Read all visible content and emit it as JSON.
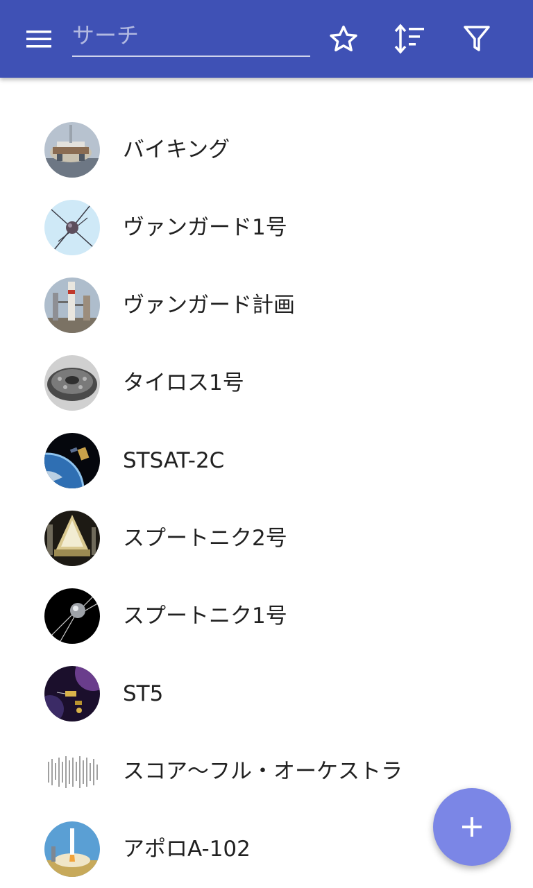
{
  "toolbar": {
    "menu_icon": "menu-icon",
    "search_placeholder": "サーチ",
    "search_value": "",
    "favorite_icon": "star-outline-icon",
    "sort_icon": "sort-icon",
    "filter_icon": "filter-icon",
    "color": "#3f51b5"
  },
  "items": [
    {
      "label": "バイキング"
    },
    {
      "label": "ヴァンガード1号"
    },
    {
      "label": "ヴァンガード計画"
    },
    {
      "label": "タイロス1号"
    },
    {
      "label": "STSAT-2C"
    },
    {
      "label": "スプートニク2号"
    },
    {
      "label": "スプートニク1号"
    },
    {
      "label": "ST5"
    },
    {
      "label": "スコア〜フル・オーケストラ"
    },
    {
      "label": "アポロA-102"
    }
  ],
  "fab": {
    "icon": "plus-icon",
    "color": "#7b86e6"
  }
}
